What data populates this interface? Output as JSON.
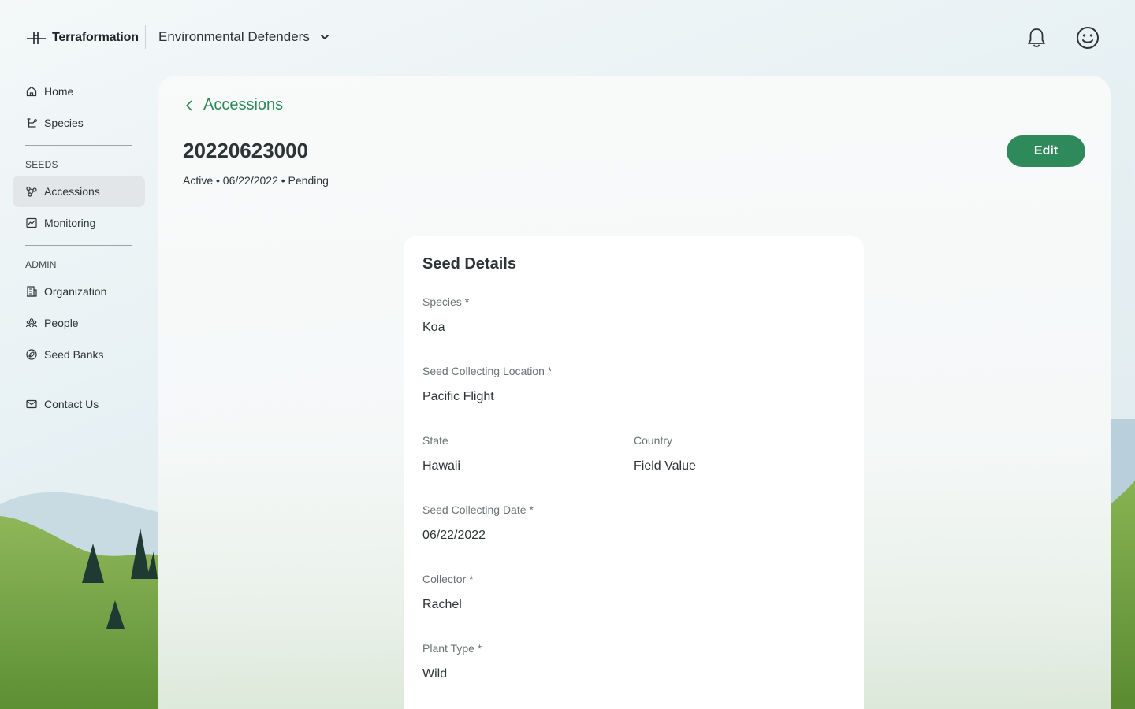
{
  "app": {
    "brand": "Terraformation",
    "org_name": "Environmental Defenders"
  },
  "header": {
    "icons": [
      "bell-icon",
      "smiley-avatar-icon"
    ]
  },
  "sidebar": {
    "items_top": [
      {
        "label": "Home",
        "icon": "home-icon"
      },
      {
        "label": "Species",
        "icon": "species-icon"
      }
    ],
    "seeds_section": "SEEDS",
    "seeds_items": [
      {
        "label": "Accessions",
        "icon": "accessions-icon",
        "active": true
      },
      {
        "label": "Monitoring",
        "icon": "monitoring-icon"
      }
    ],
    "admin_section": "ADMIN",
    "admin_items": [
      {
        "label": "Organization",
        "icon": "organization-icon"
      },
      {
        "label": "People",
        "icon": "people-icon"
      },
      {
        "label": "Seed Banks",
        "icon": "seed-bank-icon"
      }
    ],
    "bottom_items": [
      {
        "label": "Contact Us",
        "icon": "mail-icon"
      }
    ]
  },
  "main": {
    "breadcrumb": "Accessions",
    "title": "20220623000",
    "status_line": "Active • 06/22/2022 • Pending",
    "edit_label": "Edit"
  },
  "card": {
    "title": "Seed Details",
    "fields": {
      "species": {
        "label": "Species *",
        "value": "Koa"
      },
      "location": {
        "label": "Seed Collecting Location *",
        "value": "Pacific Flight"
      },
      "state": {
        "label": "State",
        "value": "Hawaii"
      },
      "country": {
        "label": "Country",
        "value": "Field Value"
      },
      "date": {
        "label": "Seed Collecting Date *",
        "value": "06/22/2022"
      },
      "collector": {
        "label": "Collector *",
        "value": "Rachel"
      },
      "plant_type": {
        "label": "Plant Type *",
        "value": "Wild"
      }
    }
  },
  "colors": {
    "accent": "#2f8a5b",
    "link": "#2c8a57",
    "active_nav": "#e3e6e8"
  }
}
